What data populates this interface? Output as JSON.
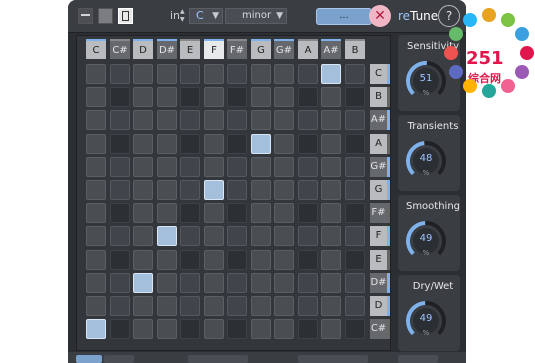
{
  "topbar": {
    "in_label": "in",
    "key_value": "C",
    "scale_value": "minor",
    "dots_label": "...",
    "close_glyph": "✕",
    "logo_prefix": "re",
    "logo_suffix": "Tune",
    "help_glyph": "?"
  },
  "keys": [
    {
      "name": "C",
      "black": false,
      "active": true,
      "lit": false
    },
    {
      "name": "C#",
      "black": true,
      "active": false,
      "lit": false
    },
    {
      "name": "D",
      "black": false,
      "active": true,
      "lit": false
    },
    {
      "name": "D#",
      "black": true,
      "active": true,
      "lit": false
    },
    {
      "name": "E",
      "black": false,
      "active": false,
      "lit": false
    },
    {
      "name": "F",
      "black": false,
      "active": true,
      "lit": true
    },
    {
      "name": "F#",
      "black": true,
      "active": false,
      "lit": false
    },
    {
      "name": "G",
      "black": false,
      "active": true,
      "lit": false
    },
    {
      "name": "G#",
      "black": true,
      "active": true,
      "lit": false
    },
    {
      "name": "A",
      "black": false,
      "active": false,
      "lit": false
    },
    {
      "name": "A#",
      "black": true,
      "active": true,
      "lit": false
    },
    {
      "name": "B",
      "black": false,
      "active": false,
      "lit": false
    }
  ],
  "rows": [
    {
      "name": "C",
      "black": false,
      "active": true
    },
    {
      "name": "B",
      "black": false,
      "active": false
    },
    {
      "name": "A#",
      "black": true,
      "active": true
    },
    {
      "name": "A",
      "black": false,
      "active": false
    },
    {
      "name": "G#",
      "black": true,
      "active": true
    },
    {
      "name": "G",
      "black": false,
      "active": true
    },
    {
      "name": "F#",
      "black": true,
      "active": false
    },
    {
      "name": "F",
      "black": false,
      "active": true
    },
    {
      "name": "E",
      "black": false,
      "active": false
    },
    {
      "name": "D#",
      "black": true,
      "active": true
    },
    {
      "name": "D",
      "black": false,
      "active": true
    },
    {
      "name": "C#",
      "black": true,
      "active": false
    }
  ],
  "mapping": [
    {
      "row": 1,
      "col": 10
    },
    {
      "row": 4,
      "col": 7
    },
    {
      "row": 6,
      "col": 5
    },
    {
      "row": 8,
      "col": 3
    },
    {
      "row": 10,
      "col": 2
    },
    {
      "row": 12,
      "col": 0
    }
  ],
  "controls": [
    {
      "title": "Sensitivity",
      "value": "51",
      "unit": "%",
      "fraction": 0.51
    },
    {
      "title": "Transients",
      "value": "48",
      "unit": "%",
      "fraction": 0.48
    },
    {
      "title": "Smoothing",
      "value": "49",
      "unit": "%",
      "fraction": 0.49
    },
    {
      "title": "Dry/Wet",
      "value": "49",
      "unit": "%",
      "fraction": 0.49
    }
  ],
  "watermark": {
    "number": "251",
    "tag": "综合网"
  },
  "colors": {
    "accent": "#7fb2ea",
    "value_text": "#9cc6ff",
    "close": "#b01c3f"
  }
}
